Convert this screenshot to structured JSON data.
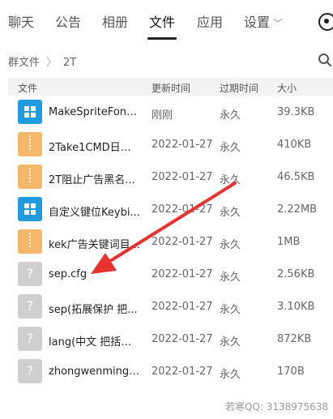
{
  "tabs": [
    {
      "label": "聊天",
      "active": false
    },
    {
      "label": "公告",
      "active": false
    },
    {
      "label": "相册",
      "active": false
    },
    {
      "label": "文件",
      "active": true
    },
    {
      "label": "应用",
      "active": false
    },
    {
      "label": "设置",
      "active": false
    }
  ],
  "breadcrumb": {
    "root": "群文件",
    "current": "2T"
  },
  "columns": {
    "name": "文件",
    "updated": "更新时间",
    "expires": "过期时间",
    "size": "大小"
  },
  "files": [
    {
      "name": "MakeSpriteFont....",
      "updated": "刚刚",
      "expires": "永久",
      "size": "39.3KB",
      "icon": "windows-file-icon"
    },
    {
      "name": "2Take1CMD日志...",
      "updated": "2022-01-27",
      "expires": "永久",
      "size": "410KB",
      "icon": "zip-file-icon"
    },
    {
      "name": "2T阻止广告黑名...",
      "updated": "2022-01-27",
      "expires": "永久",
      "size": "46.5KB",
      "icon": "zip-file-icon"
    },
    {
      "name": "自定义键位Keybi...",
      "updated": "2022-01-27",
      "expires": "永久",
      "size": "2.22MB",
      "icon": "windows-file-icon"
    },
    {
      "name": "kek广告关键词目...",
      "updated": "2022-01-27",
      "expires": "永久",
      "size": "1MB",
      "icon": "zip-file-icon"
    },
    {
      "name": "sep.cfg",
      "updated": "2022-01-27",
      "expires": "永久",
      "size": "2.56KB",
      "icon": "unknown-file-icon"
    },
    {
      "name": "sep(拓展保护 把...",
      "updated": "2022-01-27",
      "expires": "永久",
      "size": "3.10KB",
      "icon": "unknown-file-icon"
    },
    {
      "name": "lang(中文 把括号...",
      "updated": "2022-01-27",
      "expires": "永久",
      "size": "872KB",
      "icon": "unknown-file-icon"
    },
    {
      "name": "zhongwenming(...",
      "updated": "2022-01-27",
      "expires": "永久",
      "size": "170B",
      "icon": "unknown-file-icon"
    }
  ],
  "watermark": "若寒QQ: 3138975638",
  "colors": {
    "arrow": "#e8322f",
    "windows_icon": "#1f9bde",
    "zip_icon": "#f7b76b",
    "unknown_icon": "#cfcfcf"
  }
}
